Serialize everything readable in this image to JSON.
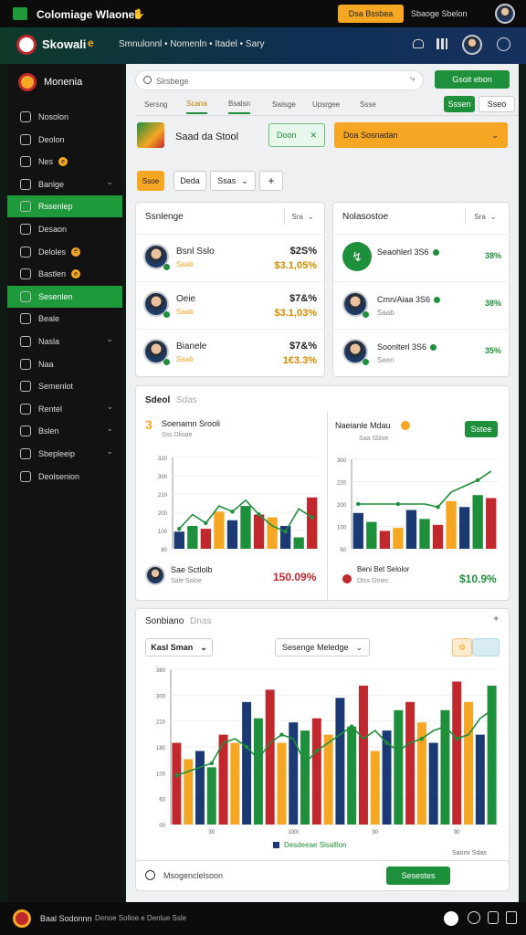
{
  "topbar": {
    "title": "Colomiage Wlaonel",
    "upgrade_label": "Dsa Bssbea",
    "user_label": "Sbaoge Sbelon"
  },
  "appbar": {
    "brand": "Skowali",
    "brand_badge": "e",
    "nav": "Smnulonnl • Nomenln • Itadel • Sary"
  },
  "sidebar": {
    "header": "Monenia",
    "items": [
      {
        "label": "Nosolon",
        "active": false
      },
      {
        "label": "Deolon",
        "active": false
      },
      {
        "label": "Nes",
        "active": false,
        "badge": "e"
      },
      {
        "label": "Banlge",
        "active": false,
        "chevron": true
      },
      {
        "label": "Rssenlep",
        "active": true
      },
      {
        "label": "Desaon",
        "active": false
      },
      {
        "label": "Deloles",
        "active": false,
        "badge": "e"
      },
      {
        "label": "Bastlen",
        "active": false,
        "badge": "e"
      },
      {
        "label": "Sesenlen",
        "active": true
      },
      {
        "label": "Beale",
        "active": false
      },
      {
        "label": "Nasla",
        "active": false,
        "chevron": true
      },
      {
        "label": "Naa",
        "active": false
      },
      {
        "label": "Semenlot",
        "active": false
      },
      {
        "label": "Rentel",
        "active": false,
        "chevron": true
      },
      {
        "label": "Bslen",
        "active": false,
        "chevron": true
      },
      {
        "label": "Sbepleeip",
        "active": false,
        "chevron": true
      },
      {
        "label": "Deolsenion",
        "active": false
      }
    ]
  },
  "search": {
    "placeholder": "Slrsbege",
    "button": "Gsoit ebon"
  },
  "tabs": [
    "Sersng",
    "Scana",
    "Bsalsn",
    "Swisge",
    "Upsrgee",
    "Ssse"
  ],
  "tab_buttons": {
    "green": "Sssen",
    "white": "Sseo"
  },
  "banner": {
    "title": "Saad da Stool",
    "mid_button": "Doon",
    "cta": "Doa Sosnadan"
  },
  "filters": {
    "active": "Ssoe",
    "chip1": "Deda",
    "select": "Ssas",
    "add": "+"
  },
  "left_list": {
    "title": "Ssnlenge",
    "select": "Sra",
    "rows": [
      {
        "name": "Bsnl Sslo",
        "sub": "Saab",
        "amount": "$2S%",
        "change": "$3.1,05%"
      },
      {
        "name": "Oeie",
        "sub": "Saab",
        "amount": "$7&%",
        "change": "$3.1,03%"
      },
      {
        "name": "Bianele",
        "sub": "Saab",
        "amount": "$7&%",
        "change": "1€3.3%"
      }
    ]
  },
  "right_list": {
    "title": "Nolasostoe",
    "select": "Sra",
    "rows": [
      {
        "name": "Seaohlerl 3S6",
        "sub": "",
        "pct": "38%"
      },
      {
        "name": "Cmn/Aiaa 3S6",
        "sub": "Saab",
        "pct": "38%"
      },
      {
        "name": "Soonlterl 3S6",
        "sub": "Seen",
        "pct": "35%"
      }
    ]
  },
  "mid_section": {
    "title": "Sdeol",
    "subtitle": "Sdas"
  },
  "chart_left": {
    "title": "Soenamn Srooli",
    "sub": "Sss Dlioae",
    "yticks": [
      "320",
      "300",
      "210",
      "200",
      "100",
      "80"
    ],
    "footer_name": "Sae Sctlolb",
    "footer_sub": "Sale Soloe",
    "footer_value": "150.09%"
  },
  "chart_right": {
    "title": "Naeianle Mdau",
    "sub": "Saa Sbloe",
    "button": "Sstee",
    "yticks": [
      "300",
      "220",
      "200",
      "100",
      "50"
    ],
    "footer_name": "Beni Bet Selolor",
    "footer_sub": "Dtss Gtnec",
    "footer_value": "$10.9%"
  },
  "bottom_section": {
    "title": "Sonbiano",
    "title_sub": "Dnas",
    "select1": "Kasl Sman",
    "select2": "Sesenge Meledge",
    "yticks": [
      "380",
      "300",
      "210",
      "180",
      "100",
      "60",
      "00"
    ],
    "xticks": [
      "30",
      "100!",
      "30",
      "30"
    ],
    "legend": "Desdeeae Slsalllon",
    "corner": "Saonv Sdas",
    "search_placeholder": "Msogenclelsoon",
    "search_button": "Sesestes"
  },
  "footer": {
    "left": "Baal Sodonnn",
    "center": "Denoe Solloe e Denlue Ssle",
    "right": ""
  },
  "colors": {
    "green": "#1e8f3a",
    "orange": "#f5a623",
    "navy": "#1b3a73",
    "red": "#c0282d"
  },
  "chart_data": [
    {
      "type": "bar",
      "name_hint": "left mini chart",
      "categories": [
        "1",
        "2",
        "3",
        "4",
        "5",
        "6",
        "7",
        "8",
        "9",
        "10",
        "11"
      ],
      "series": [
        {
          "values": [
            60,
            80,
            70,
            130,
            100,
            150,
            120,
            110,
            80,
            40,
            180
          ]
        }
      ],
      "line": [
        70,
        120,
        90,
        150,
        130,
        170,
        120,
        80,
        60,
        140,
        110
      ],
      "ylim": [
        0,
        320
      ]
    },
    {
      "type": "bar",
      "name_hint": "right mini chart",
      "categories": [
        "1",
        "2",
        "3",
        "4",
        "5",
        "6",
        "7",
        "8",
        "9",
        "10",
        "11"
      ],
      "series": [
        {
          "values": [
            120,
            90,
            60,
            70,
            130,
            100,
            80,
            160,
            140,
            180,
            170
          ]
        }
      ],
      "line": [
        150,
        150,
        150,
        150,
        150,
        150,
        140,
        190,
        210,
        230,
        260
      ],
      "ylim": [
        0,
        300
      ]
    },
    {
      "type": "bar",
      "name_hint": "main chart",
      "categories": [
        "1",
        "2",
        "3",
        "4",
        "5",
        "6",
        "7",
        "8",
        "9",
        "10",
        "11",
        "12",
        "13",
        "14",
        "15",
        "16",
        "17",
        "18",
        "19",
        "20",
        "21",
        "22",
        "23",
        "24",
        "25",
        "26",
        "27",
        "28"
      ],
      "series": [
        {
          "values": [
            200,
            160,
            180,
            140,
            220,
            200,
            300,
            260,
            330,
            200,
            250,
            230,
            260,
            220,
            310,
            240,
            340,
            180,
            230,
            280,
            300,
            250,
            200,
            280,
            350,
            300,
            220,
            340
          ]
        }
      ],
      "line": [
        120,
        130,
        140,
        150,
        200,
        210,
        190,
        160,
        200,
        220,
        210,
        150,
        180,
        200,
        220,
        240,
        210,
        230,
        200,
        180,
        200,
        210,
        230,
        240,
        210,
        220,
        260,
        280
      ],
      "ylim": [
        0,
        380
      ]
    }
  ]
}
